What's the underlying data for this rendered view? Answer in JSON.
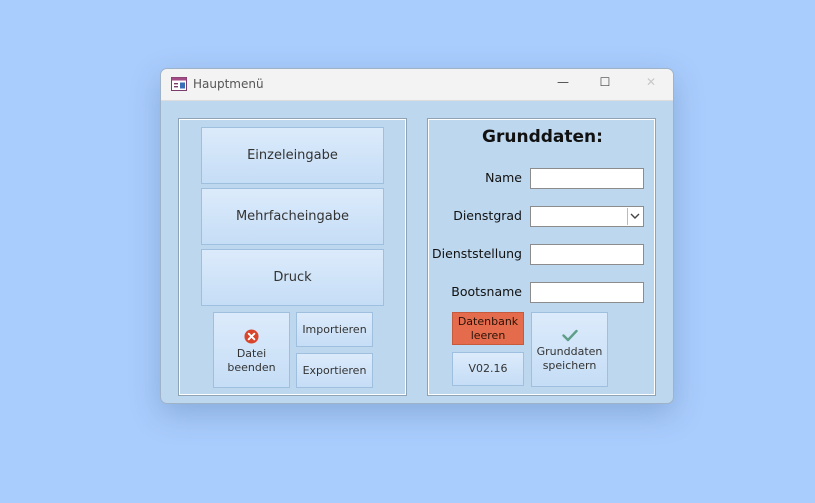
{
  "window": {
    "title": "Hauptmenü",
    "controls": {
      "minimize": "—",
      "maximize": "☐",
      "close": "✕"
    }
  },
  "left_panel": {
    "einzeleingabe_label": "Einzeleingabe",
    "mehrfacheingabe_label": "Mehrfacheingabe",
    "druck_label": "Druck",
    "datei_beenden_label": [
      "Datei",
      "beenden"
    ],
    "importieren_label": "Importieren",
    "exportieren_label": "Exportieren"
  },
  "right_panel": {
    "heading": "Grunddaten:",
    "fields": {
      "name": {
        "label": "Name",
        "value": ""
      },
      "dienstgrad": {
        "label": "Dienstgrad",
        "value": ""
      },
      "dienststellung": {
        "label": "Dienststellung",
        "value": ""
      },
      "bootsname": {
        "label": "Bootsname",
        "value": ""
      }
    },
    "datenbank_leeren_label": [
      "Datenbank",
      "leeren"
    ],
    "version_label": "V02.16",
    "grunddaten_speichern_label": [
      "Grunddaten",
      "speichern"
    ]
  },
  "colors": {
    "background": "#a9cdfd",
    "form_background": "#bdd7ee",
    "danger_button": "#e46c4c",
    "close_icon": "#d9452b",
    "check_icon": "#5f9e88"
  },
  "icons": {
    "app": "form-icon",
    "exit": "close-circle-icon",
    "save": "checkmark-icon"
  }
}
